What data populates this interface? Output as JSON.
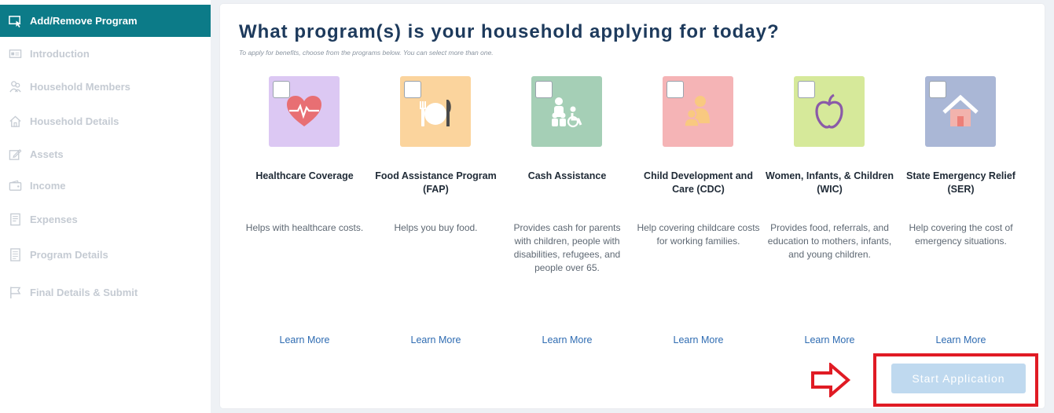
{
  "sidebar": {
    "items": [
      {
        "label": "Add/Remove Program",
        "icon": "cursor-window-icon",
        "active": true
      },
      {
        "label": "Introduction",
        "icon": "id-card-icon"
      },
      {
        "label": "Household Members",
        "icon": "people-icon"
      },
      {
        "label": "Household Details",
        "icon": "home-icon"
      },
      {
        "label": "Assets",
        "icon": "edit-icon"
      },
      {
        "label": "Income",
        "icon": "wallet-icon"
      },
      {
        "label": "Expenses",
        "icon": "receipt-icon"
      },
      {
        "label": "Program Details",
        "icon": "document-icon"
      },
      {
        "label": "Final Details & Submit",
        "icon": "flag-icon"
      }
    ]
  },
  "main": {
    "title": "What program(s) is your household applying for today?",
    "subtitle": "To apply for benefits, choose from the programs below. You can select more than one.",
    "programs": [
      {
        "name": "Healthcare Coverage",
        "description": "Helps with healthcare costs.",
        "learn_more": "Learn More",
        "color": "#dcc8f3",
        "icon": "heart-pulse-icon"
      },
      {
        "name": "Food Assistance Program (FAP)",
        "description": "Helps you buy food.",
        "learn_more": "Learn More",
        "color": "#fbd49d",
        "icon": "plate-utensils-icon"
      },
      {
        "name": "Cash Assistance",
        "description": "Provides cash for parents with children, people with disabilities, refugees, and people over 65.",
        "learn_more": "Learn More",
        "color": "#a5cfb6",
        "icon": "family-wheelchair-icon"
      },
      {
        "name": "Child Development and Care (CDC)",
        "description": "Help covering childcare costs for working families.",
        "learn_more": "Learn More",
        "color": "#f5b4b6",
        "icon": "parent-child-icon"
      },
      {
        "name": "Women, Infants, & Children (WIC)",
        "description": "Provides food, referrals, and education to mothers, infants, and young children.",
        "learn_more": "Learn More",
        "color": "#d6e99a",
        "icon": "apple-icon"
      },
      {
        "name": "State Emergency Relief (SER)",
        "description": "Help covering the cost of emergency situations.",
        "learn_more": "Learn More",
        "color": "#aab7d6",
        "icon": "house-icon"
      }
    ],
    "start_button": "Start Application"
  },
  "colors": {
    "accent": "#0c7b88",
    "title": "#1d3a5c",
    "link": "#2f6cb2",
    "button": "#bfd9ef",
    "annotation": "#e01b24"
  }
}
